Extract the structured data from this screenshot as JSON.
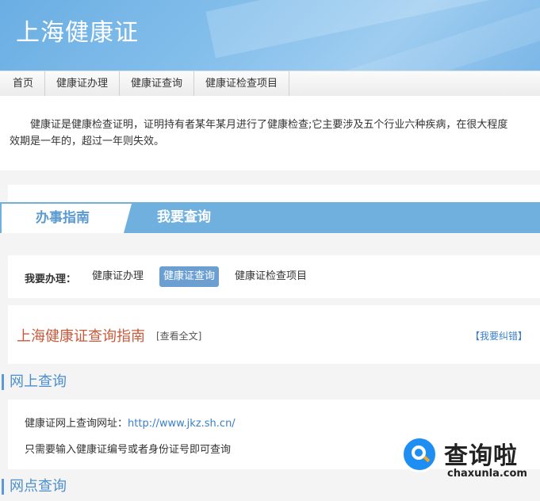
{
  "header": {
    "title": "上海健康证"
  },
  "nav": {
    "items": [
      "首页",
      "健康证办理",
      "健康证查询",
      "健康证检查项目"
    ]
  },
  "intro": {
    "line1": "健康证是健康检查证明，证明持有者某年某月进行了健康检查;它主要涉及五个行业六种疾病，在很大程度",
    "line2": "效期是一年的，超过一年则失效。"
  },
  "tabs": {
    "active": "办事指南",
    "other": "我要查询"
  },
  "handle": {
    "label": "我要办理：",
    "options": [
      "健康证办理",
      "健康证查询",
      "健康证检查项目"
    ],
    "selected_index": 1
  },
  "guide": {
    "title": "上海健康证查询指南",
    "view_all": "[查看全文]",
    "correct": "【我要纠错】"
  },
  "online_query": {
    "heading": "网上查询",
    "url_label": "健康证网上查询网址：",
    "url": "http://www.jkz.sh.cn/",
    "note": "只需要输入健康证编号或者身份证号即可查询"
  },
  "outlet_query": {
    "heading": "网点查询"
  },
  "watermark": {
    "cn": "查询啦",
    "en": "chaxunla.com"
  },
  "colors": {
    "accent": "#6fb0de",
    "title_red": "#c85a3c",
    "link_blue": "#3b7fc6"
  }
}
